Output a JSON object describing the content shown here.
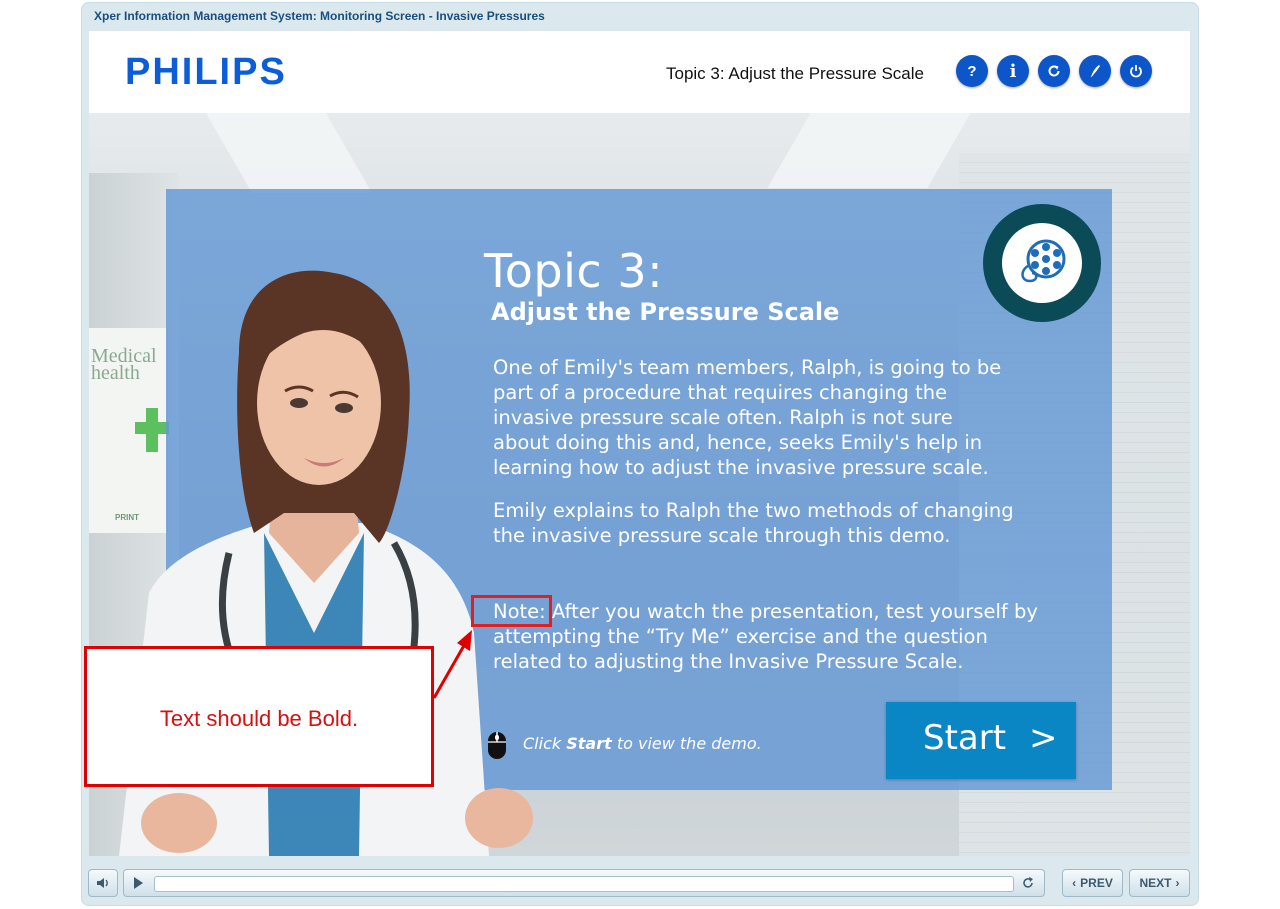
{
  "window": {
    "title": "Xper Information Management System: Monitoring Screen - Invasive Pressures"
  },
  "header": {
    "logo": "PHILIPS",
    "topic_title": "Topic 3: Adjust the Pressure Scale",
    "buttons": [
      {
        "icon": "help-icon",
        "glyph": "?"
      },
      {
        "icon": "info-icon",
        "glyph": "i"
      },
      {
        "icon": "replay-icon",
        "glyph": ""
      },
      {
        "icon": "pen-icon",
        "glyph": ""
      },
      {
        "icon": "power-icon",
        "glyph": ""
      }
    ]
  },
  "content": {
    "heading": "Topic 3:",
    "subheading": "Adjust the Pressure Scale",
    "para1": [
      "One of Emily's team members, Ralph, is going to be",
      "part of a procedure that requires changing the",
      "invasive pressure scale often. Ralph is not sure",
      "about doing this and, hence, seeks Emily's help in",
      "learning how to adjust the invasive pressure scale."
    ],
    "para2": [
      "Emily explains to Ralph the two methods of changing",
      "the invasive pressure scale through this demo."
    ],
    "note_label": "Note:",
    "note_lines": [
      " After you watch the presentation, test yourself by",
      "attempting the “Try Me” exercise and the question",
      "related to adjusting the Invasive Pressure Scale."
    ],
    "instruction_prefix": "Click ",
    "instruction_bold": "Start",
    "instruction_suffix": " to view the demo.",
    "start_label": "Start",
    "start_chevron": ">",
    "poster_text": "Medical health",
    "poster_print": "PRINT"
  },
  "annotation": {
    "callout_text": "Text should be Bold."
  },
  "footer": {
    "prev_label": "PREV",
    "next_label": "NEXT",
    "progress": 0.0
  },
  "colors": {
    "brand_blue": "#0b5ed7",
    "panel_blue": "#6296d4",
    "start_button": "#0a86c4",
    "annotation_red": "#e00000"
  }
}
